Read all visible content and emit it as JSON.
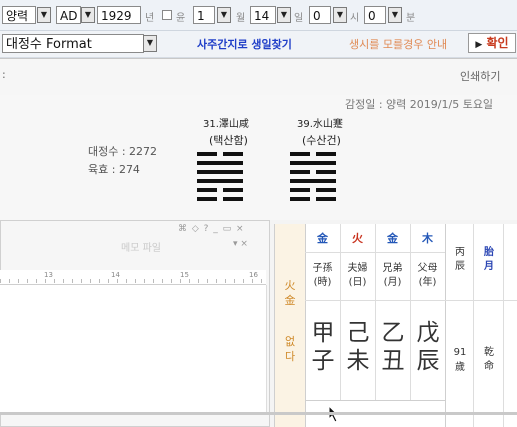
{
  "toolbar": {
    "calendar_type": "양력",
    "era": "AD",
    "year": "1929",
    "year_unit": "년",
    "leap_label": "윤",
    "month": "1",
    "month_unit": "월",
    "day": "14",
    "day_unit": "일",
    "hour": "0",
    "hour_unit": "시",
    "minute": "0",
    "minute_unit": "분",
    "dropdown_glyph": "▼",
    "format_select": "대정수 Format",
    "find_date_link": "사주간지로 생일찾기",
    "unknown_hour_link": "생시를 모를경우 안내",
    "confirm_label": "확인",
    "confirm_arrow": "▶"
  },
  "panel": {
    "colon": ":",
    "print_link": "인쇄하기",
    "reading_date": "감정일 : 양력 2019/1/5 토요일",
    "daejeongsu": "대정수 : 2272",
    "yukhyo": "육효 : 274",
    "hex1_title": "31.澤山咸",
    "hex1_sub": "(택산함)",
    "hex2_title": "39.水山蹇",
    "hex2_sub": "(수산건)"
  },
  "subwindow": {
    "title_faded": "메모 파일",
    "controls": "⌘ ◇ ?  _ ▭ ×",
    "controls2": "▾ ×",
    "ruler_marks": [
      "13",
      "14",
      "15",
      "16"
    ]
  },
  "saju": {
    "side_top": "火金",
    "side_bottom": "없다",
    "elements": [
      "金",
      "火",
      "金",
      "木"
    ],
    "element_colors": [
      "#2458b8",
      "#c8321e",
      "#2458b8",
      "#2458b8"
    ],
    "relations": [
      {
        "top": "子孫",
        "bottom": "(時)"
      },
      {
        "top": "夫婦",
        "bottom": "(日)"
      },
      {
        "top": "兄弟",
        "bottom": "(月)"
      },
      {
        "top": "父母",
        "bottom": "(年)"
      }
    ],
    "stems": [
      "甲",
      "己",
      "乙",
      "戊"
    ],
    "branches": [
      "子",
      "未",
      "丑",
      "辰"
    ],
    "extra_col1_top": "丙辰",
    "extra_col1_bottom_num": "91",
    "extra_col1_bottom_label": "歲",
    "extra_col2_top": "胎月",
    "extra_col2_bottom": "乾命"
  }
}
